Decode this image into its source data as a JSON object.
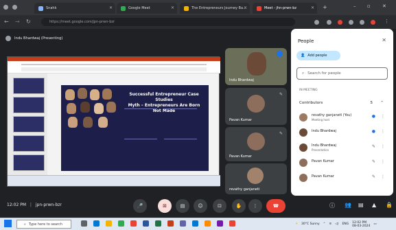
{
  "browser": {
    "tabs": [
      {
        "label": "Snahk"
      },
      {
        "label": "Google Meet"
      },
      {
        "label": "The Entrepreneurs Journey Ba..."
      },
      {
        "label": "Meet - jhn-prwn-bz"
      }
    ],
    "url": "https://meet.google.com/jpn-prwn-bzr",
    "colors": {
      "accent": "#c2e7ff",
      "red": "#ea4335"
    }
  },
  "meet": {
    "presenting_label": "Indu Bhardwaj (Presenting)",
    "slide": {
      "title_line1": "Successful Entrepreneur Case Studies",
      "title_line2": "Myth – Entrepreneurs Are Born Not Made"
    },
    "tiles": [
      {
        "name": "Indu Bhardwaj"
      },
      {
        "name": "Pavan Kumar"
      },
      {
        "name": "Pavan Kumar"
      },
      {
        "name": "revathy ganjaneti"
      }
    ],
    "clock": "12:02 PM",
    "meeting_code": "jpn-prwn-bzr"
  },
  "people": {
    "title": "People",
    "add_people": "Add people",
    "search_placeholder": "Search for people",
    "section_label": "IN MEETING",
    "contributors_label": "Contributors",
    "contributors_count": "5",
    "participants": [
      {
        "name": "revathy ganjaneti (You)",
        "sub": "Meeting host"
      },
      {
        "name": "Indu Bhardwaj",
        "sub": ""
      },
      {
        "name": "Indu Bhardwaj",
        "sub": "Presentation"
      },
      {
        "name": "Pavan Kumar",
        "sub": ""
      },
      {
        "name": "Pavan Kumar",
        "sub": ""
      }
    ]
  },
  "windows": {
    "search_placeholder": "Type here to search",
    "weather": "30°C Sunny",
    "lang": "ENG",
    "time": "12:02 PM",
    "date": "08-03-2024"
  }
}
